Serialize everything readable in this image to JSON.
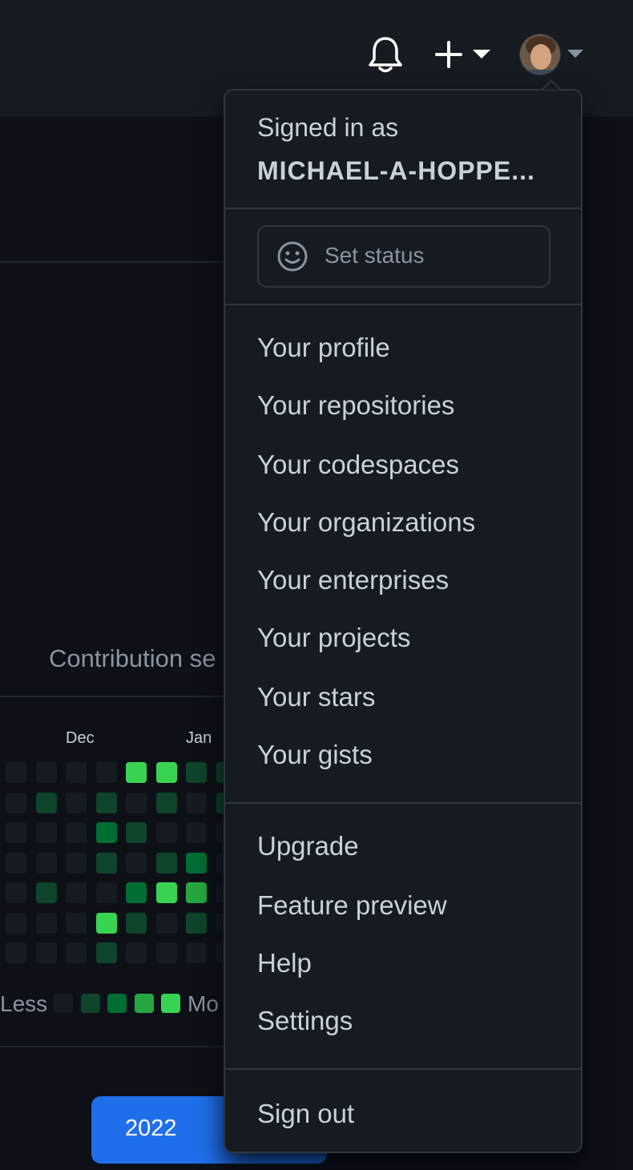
{
  "header": {
    "bell_icon": "bell-icon",
    "create_icon": "plus-icon",
    "avatar_icon": "user-avatar"
  },
  "background": {
    "contribution_title": "Contribution se",
    "months": [
      "Dec",
      "Jan"
    ],
    "legend_less": "Less",
    "legend_more": "Mo",
    "year_button": "2022",
    "colors": {
      "level0": "#161b22",
      "level1": "#0e4429",
      "level2": "#006d32",
      "level3": "#26a641",
      "level4": "#39d353"
    }
  },
  "menu": {
    "signed_in_label": "Signed in as",
    "username": "MICHAEL-A-HOPPE...",
    "status_placeholder": "Set status",
    "status_icon": "smiley-icon",
    "group1": [
      "Your profile",
      "Your repositories",
      "Your codespaces",
      "Your organizations",
      "Your enterprises",
      "Your projects",
      "Your stars",
      "Your gists"
    ],
    "group2": [
      "Upgrade",
      "Feature preview",
      "Help",
      "Settings"
    ],
    "sign_out": "Sign out"
  }
}
